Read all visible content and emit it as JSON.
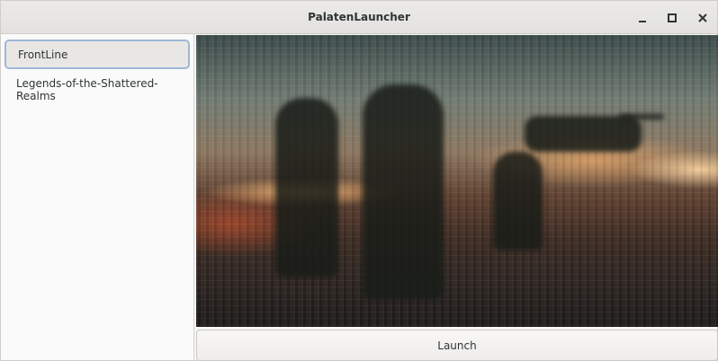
{
  "window": {
    "title": "PalatenLauncher",
    "controls": {
      "minimize_icon": "minimize-icon",
      "maximize_icon": "maximize-icon",
      "close_icon": "close-icon"
    }
  },
  "game_list": {
    "items": [
      {
        "label": "FrontLine",
        "selected": true
      },
      {
        "label": "Legends-of-the-Shattered-Realms",
        "selected": false
      }
    ]
  },
  "actions": {
    "launch_label": "Launch"
  },
  "colors": {
    "selection_border": "#9fb7d8",
    "selection_fill": "#e9e7e4",
    "titlebar": "#e8e6e3"
  }
}
